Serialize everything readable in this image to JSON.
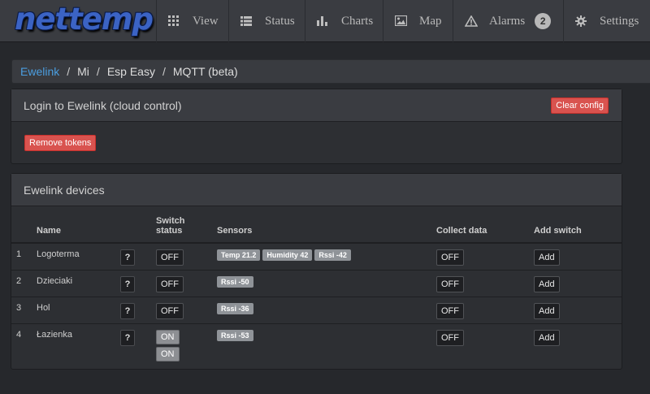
{
  "brand": "nettemp",
  "nav": [
    {
      "label": "View",
      "icon": "grid-icon"
    },
    {
      "label": "Status",
      "icon": "list-icon"
    },
    {
      "label": "Charts",
      "icon": "bar-chart-icon"
    },
    {
      "label": "Map",
      "icon": "image-icon"
    },
    {
      "label": "Alarms",
      "icon": "warning-icon",
      "badge": "2"
    },
    {
      "label": "Settings",
      "icon": "gear-icon"
    }
  ],
  "breadcrumb": {
    "link": "Ewelink",
    "items": [
      "Mi",
      "Esp Easy",
      "MQTT (beta)"
    ]
  },
  "login_panel": {
    "title": "Login to Ewelink (cloud control)",
    "clear_label": "Clear config",
    "remove_label": "Remove tokens"
  },
  "devices_panel": {
    "title": "Ewelink devices",
    "headers": {
      "name": "Name",
      "switch_status_1": "Switch",
      "switch_status_2": "status",
      "sensors": "Sensors",
      "collect": "Collect data",
      "add": "Add switch"
    },
    "help_label": "?",
    "rows": [
      {
        "num": "1",
        "name": "Logoterma",
        "switch": [
          "OFF"
        ],
        "sensors": [
          "Temp 21.2",
          "Humidity 42",
          "Rssi -42"
        ],
        "collect": "OFF",
        "add": "Add"
      },
      {
        "num": "2",
        "name": "Dzieciaki",
        "switch": [
          "OFF"
        ],
        "sensors": [
          "Rssi -50"
        ],
        "collect": "OFF",
        "add": "Add"
      },
      {
        "num": "3",
        "name": "Hol",
        "switch": [
          "OFF"
        ],
        "sensors": [
          "Rssi -36"
        ],
        "collect": "OFF",
        "add": "Add"
      },
      {
        "num": "4",
        "name": "Łazienka",
        "switch": [
          "ON",
          "ON"
        ],
        "sensors": [
          "Rssi -53"
        ],
        "collect": "OFF",
        "add": "Add"
      }
    ]
  },
  "colors": {
    "accent_link": "#4b9ee0",
    "danger": "#d9534f",
    "background": "#26282c"
  }
}
